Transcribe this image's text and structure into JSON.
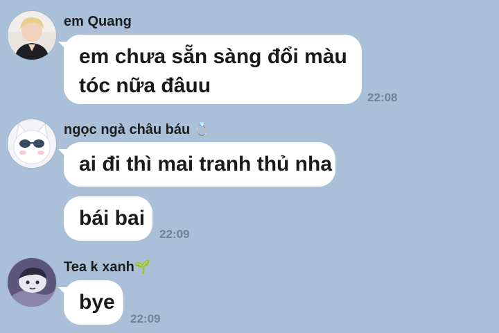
{
  "messages": [
    {
      "sender": "em Quang",
      "sender_emoji": "",
      "avatar_icon": "person-photo-avatar",
      "bubbles": [
        {
          "lines": [
            "em chưa sẵn sàng đổi màu",
            "tóc nữa đâuu"
          ],
          "time": "22:08"
        }
      ]
    },
    {
      "sender": "ngọc ngà châu báu",
      "sender_emoji": "💍",
      "avatar_icon": "white-cat-sunglasses-avatar",
      "bubbles": [
        {
          "lines": [
            "ai đi thì mai tranh thủ nha"
          ],
          "time": ""
        },
        {
          "lines": [
            "bái bai"
          ],
          "time": "22:09"
        }
      ]
    },
    {
      "sender": "Tea k xanh",
      "sender_emoji": "🌱",
      "avatar_icon": "cartoon-character-avatar",
      "bubbles": [
        {
          "lines": [
            "bye"
          ],
          "time": "22:09"
        }
      ]
    }
  ],
  "colors": {
    "chat_background": "#a9c0d8",
    "bubble": "#ffffff",
    "timestamp": "#6f8399"
  }
}
